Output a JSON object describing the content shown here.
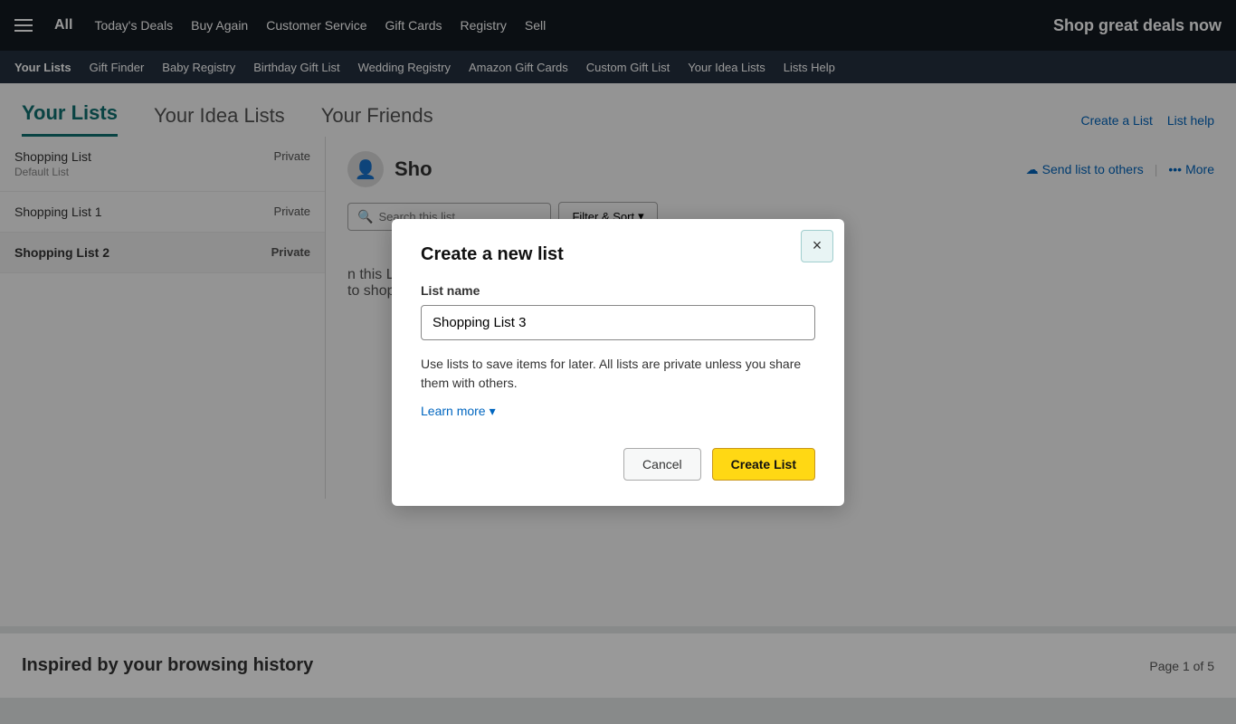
{
  "topNav": {
    "allLabel": "All",
    "links": [
      "Today's Deals",
      "Buy Again",
      "Customer Service",
      "Gift Cards",
      "Registry",
      "Sell"
    ],
    "shopDeals": "Shop great deals now"
  },
  "secNav": {
    "links": [
      {
        "label": "Your Lists",
        "active": true
      },
      {
        "label": "Gift Finder"
      },
      {
        "label": "Baby Registry"
      },
      {
        "label": "Birthday Gift List"
      },
      {
        "label": "Wedding Registry"
      },
      {
        "label": "Amazon Gift Cards"
      },
      {
        "label": "Custom Gift List"
      },
      {
        "label": "Your Idea Lists"
      },
      {
        "label": "Lists Help"
      }
    ]
  },
  "tabs": [
    {
      "label": "Your Lists",
      "active": true
    },
    {
      "label": "Your Idea Lists"
    },
    {
      "label": "Your Friends"
    }
  ],
  "rightActions": {
    "createList": "Create a List",
    "listHelp": "List help"
  },
  "sidebar": {
    "items": [
      {
        "name": "Shopping List",
        "sub": "Default List",
        "privacy": "Private",
        "active": false
      },
      {
        "name": "Shopping List 1",
        "sub": "",
        "privacy": "Private",
        "active": false
      },
      {
        "name": "Shopping List 2",
        "sub": "",
        "privacy": "Private",
        "active": true
      }
    ]
  },
  "mainList": {
    "title": "Sho",
    "sendListLabel": "Send list to others",
    "moreLabel": "More",
    "searchPlaceholder": "Search this list",
    "filterSort": "Filter & Sort",
    "emptyLine1": "n this List.",
    "emptyLine2": "to shop for."
  },
  "modal": {
    "title": "Create a new list",
    "closeLabel": "×",
    "fieldLabel": "List name",
    "inputValue": "Shopping List 3",
    "description": "Use lists to save items for later. All lists are private unless you share them with others.",
    "learnMore": "Learn more",
    "cancelLabel": "Cancel",
    "createLabel": "Create List"
  },
  "bottomSection": {
    "title": "Inspired by your browsing history",
    "pageCount": "Page 1 of 5"
  }
}
